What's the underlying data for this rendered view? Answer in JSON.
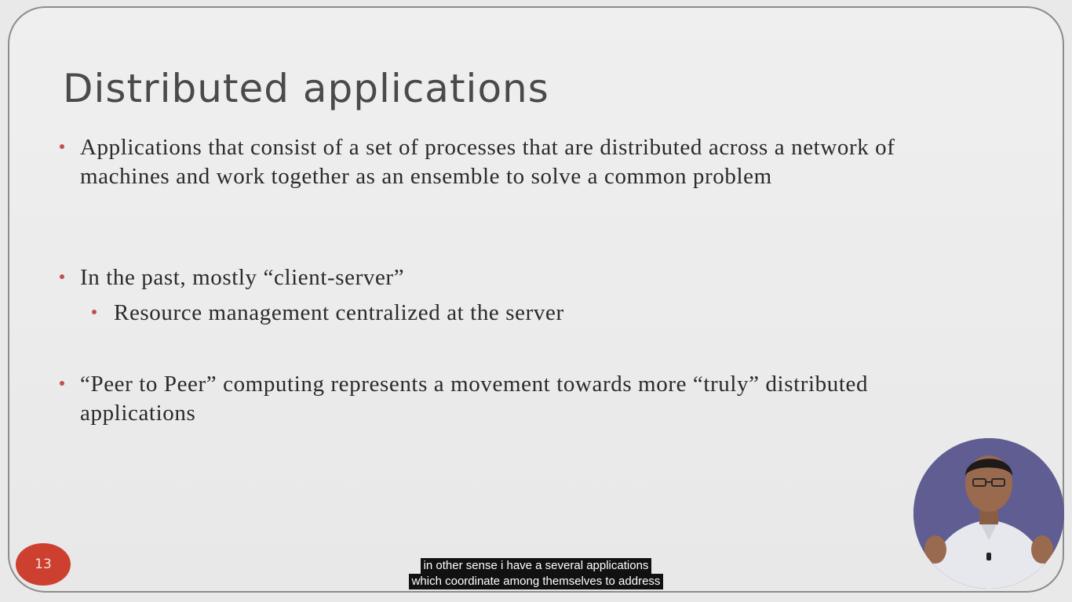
{
  "slide": {
    "title": "Distributed applications",
    "page_number": "13",
    "bullets": [
      "Applications that consist of a set of processes that are distributed across a network of machines and work together as an ensemble to solve a common problem",
      "In the past, mostly “client-server”",
      "“Peer to Peer” computing represents a movement towards more “truly” distributed applications"
    ],
    "sub_bullets": [
      "Resource management centralized at the server"
    ],
    "accent_color": "#cd3f2e"
  },
  "presenter": {
    "icon": "presenter-video-feed"
  },
  "captions": {
    "line1": "in other sense i have a several applications",
    "line2": "which coordinate among themselves to address"
  }
}
